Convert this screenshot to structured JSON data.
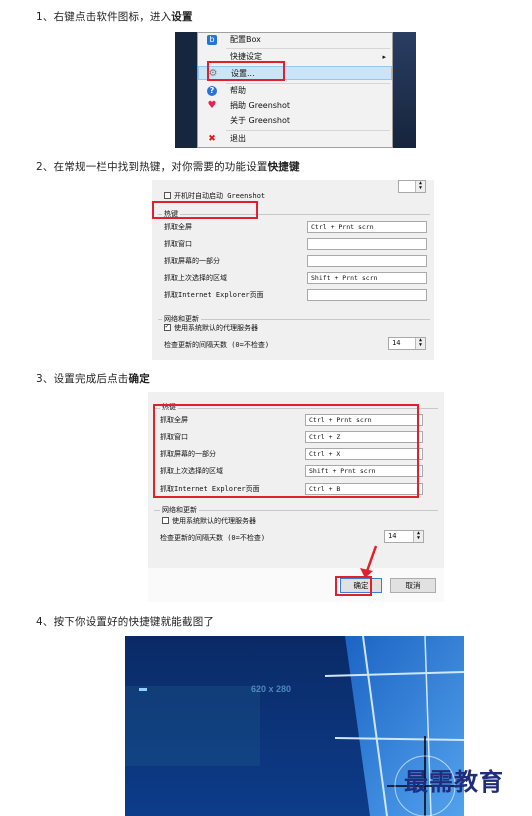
{
  "steps": [
    {
      "number": "1、",
      "text": "右键点击软件图标，进入",
      "bold": "设置"
    },
    {
      "number": "2、",
      "text": "在常规一栏中找到热键，对你需要的功能设置",
      "bold": "快捷键"
    },
    {
      "number": "3、",
      "text": "设置完成后点击",
      "bold": "确定"
    },
    {
      "number": "4、",
      "text": "按下你设置好的快捷键就能截图了",
      "bold": ""
    }
  ],
  "context_menu": {
    "items": [
      {
        "label": "配置Box",
        "icon": "box-icon"
      },
      {
        "label": "快捷设定",
        "icon": "",
        "submenu": "▸"
      },
      {
        "label": "设置...",
        "icon": "gear-icon"
      },
      {
        "label": "帮助",
        "icon": "help-icon"
      },
      {
        "label": "捐助 Greenshot",
        "icon": "heart-icon"
      },
      {
        "label": "关于 Greenshot",
        "icon": ""
      },
      {
        "label": "退出",
        "icon": "close-icon"
      }
    ]
  },
  "panel2": {
    "autostart_label": "开机时自动启动 Greenshot",
    "hotkeys_title": "热键",
    "rows": [
      {
        "label": "抓取全屏",
        "value": "Ctrl + Prnt scrn"
      },
      {
        "label": "抓取窗口",
        "value": ""
      },
      {
        "label": "抓取屏幕的一部分",
        "value": ""
      },
      {
        "label": "抓取上次选择的区域",
        "value": "Shift + Prnt scrn"
      },
      {
        "label": "抓取Internet Explorer页面",
        "value": ""
      }
    ],
    "network_title": "网络和更新",
    "proxy_label": "使用系统默认的代理服务器",
    "update_label": "检查更新的间隔天数 (0=不检查)",
    "update_value": "14"
  },
  "panel3": {
    "hotkeys_title": "热键",
    "rows": [
      {
        "label": "抓取全屏",
        "value": "Ctrl + Prnt scrn"
      },
      {
        "label": "抓取窗口",
        "value": "Ctrl + Z"
      },
      {
        "label": "抓取屏幕的一部分",
        "value": "Ctrl + X"
      },
      {
        "label": "抓取上次选择的区域",
        "value": "Shift + Prnt scrn"
      },
      {
        "label": "抓取Internet Explorer页面",
        "value": "Ctrl + B"
      }
    ],
    "network_title": "网络和更新",
    "proxy_label": "使用系统默认的代理服务器",
    "update_label": "检查更新的间隔天数 (0=不检查)",
    "update_value": "14",
    "ok_label": "确定",
    "cancel_label": "取消"
  },
  "desktop": {
    "selection_size": "620 x 280"
  },
  "watermark": "最需教育",
  "colors": {
    "highlight_red": "#e0202a",
    "win10_blue": "#0b2f70"
  }
}
